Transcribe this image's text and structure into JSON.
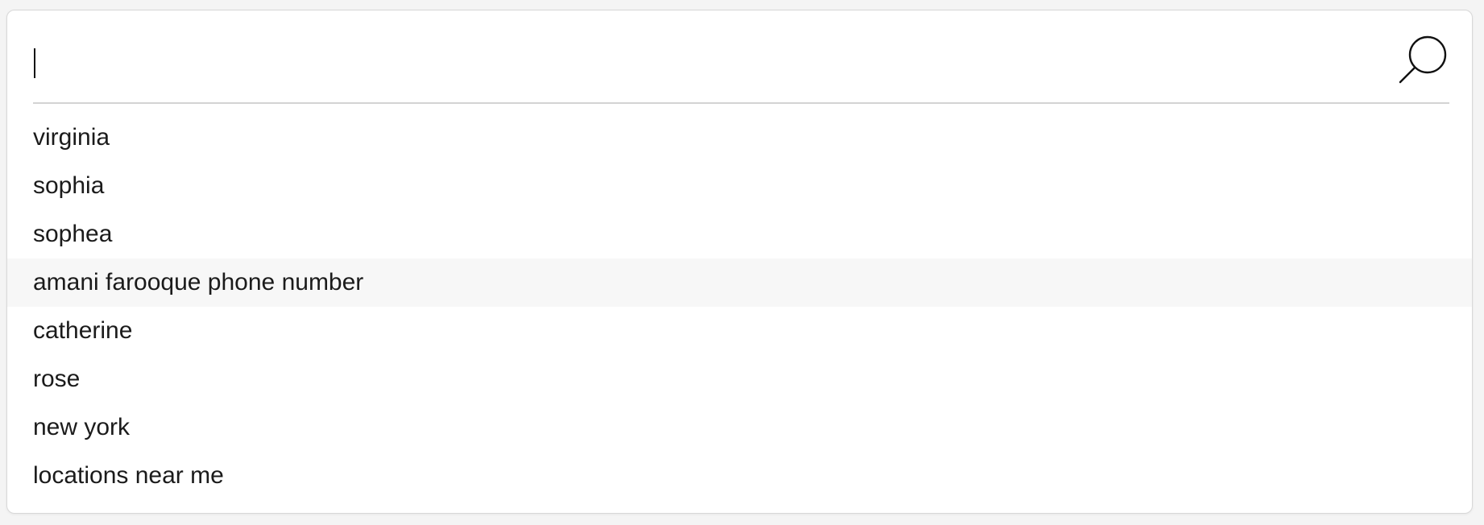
{
  "search": {
    "value": "",
    "placeholder": ""
  },
  "icons": {
    "submit": "search-icon"
  },
  "colors": {
    "highlight_row": "#f7f7f7",
    "divider": "#d3d3d3",
    "text": "#1b1b1b"
  },
  "suggestions": [
    {
      "label": "virginia"
    },
    {
      "label": "sophia"
    },
    {
      "label": "sophea"
    },
    {
      "label": "amani farooque phone number",
      "highlighted": true
    },
    {
      "label": "catherine"
    },
    {
      "label": "rose"
    },
    {
      "label": "new york"
    },
    {
      "label": "locations near me"
    }
  ]
}
